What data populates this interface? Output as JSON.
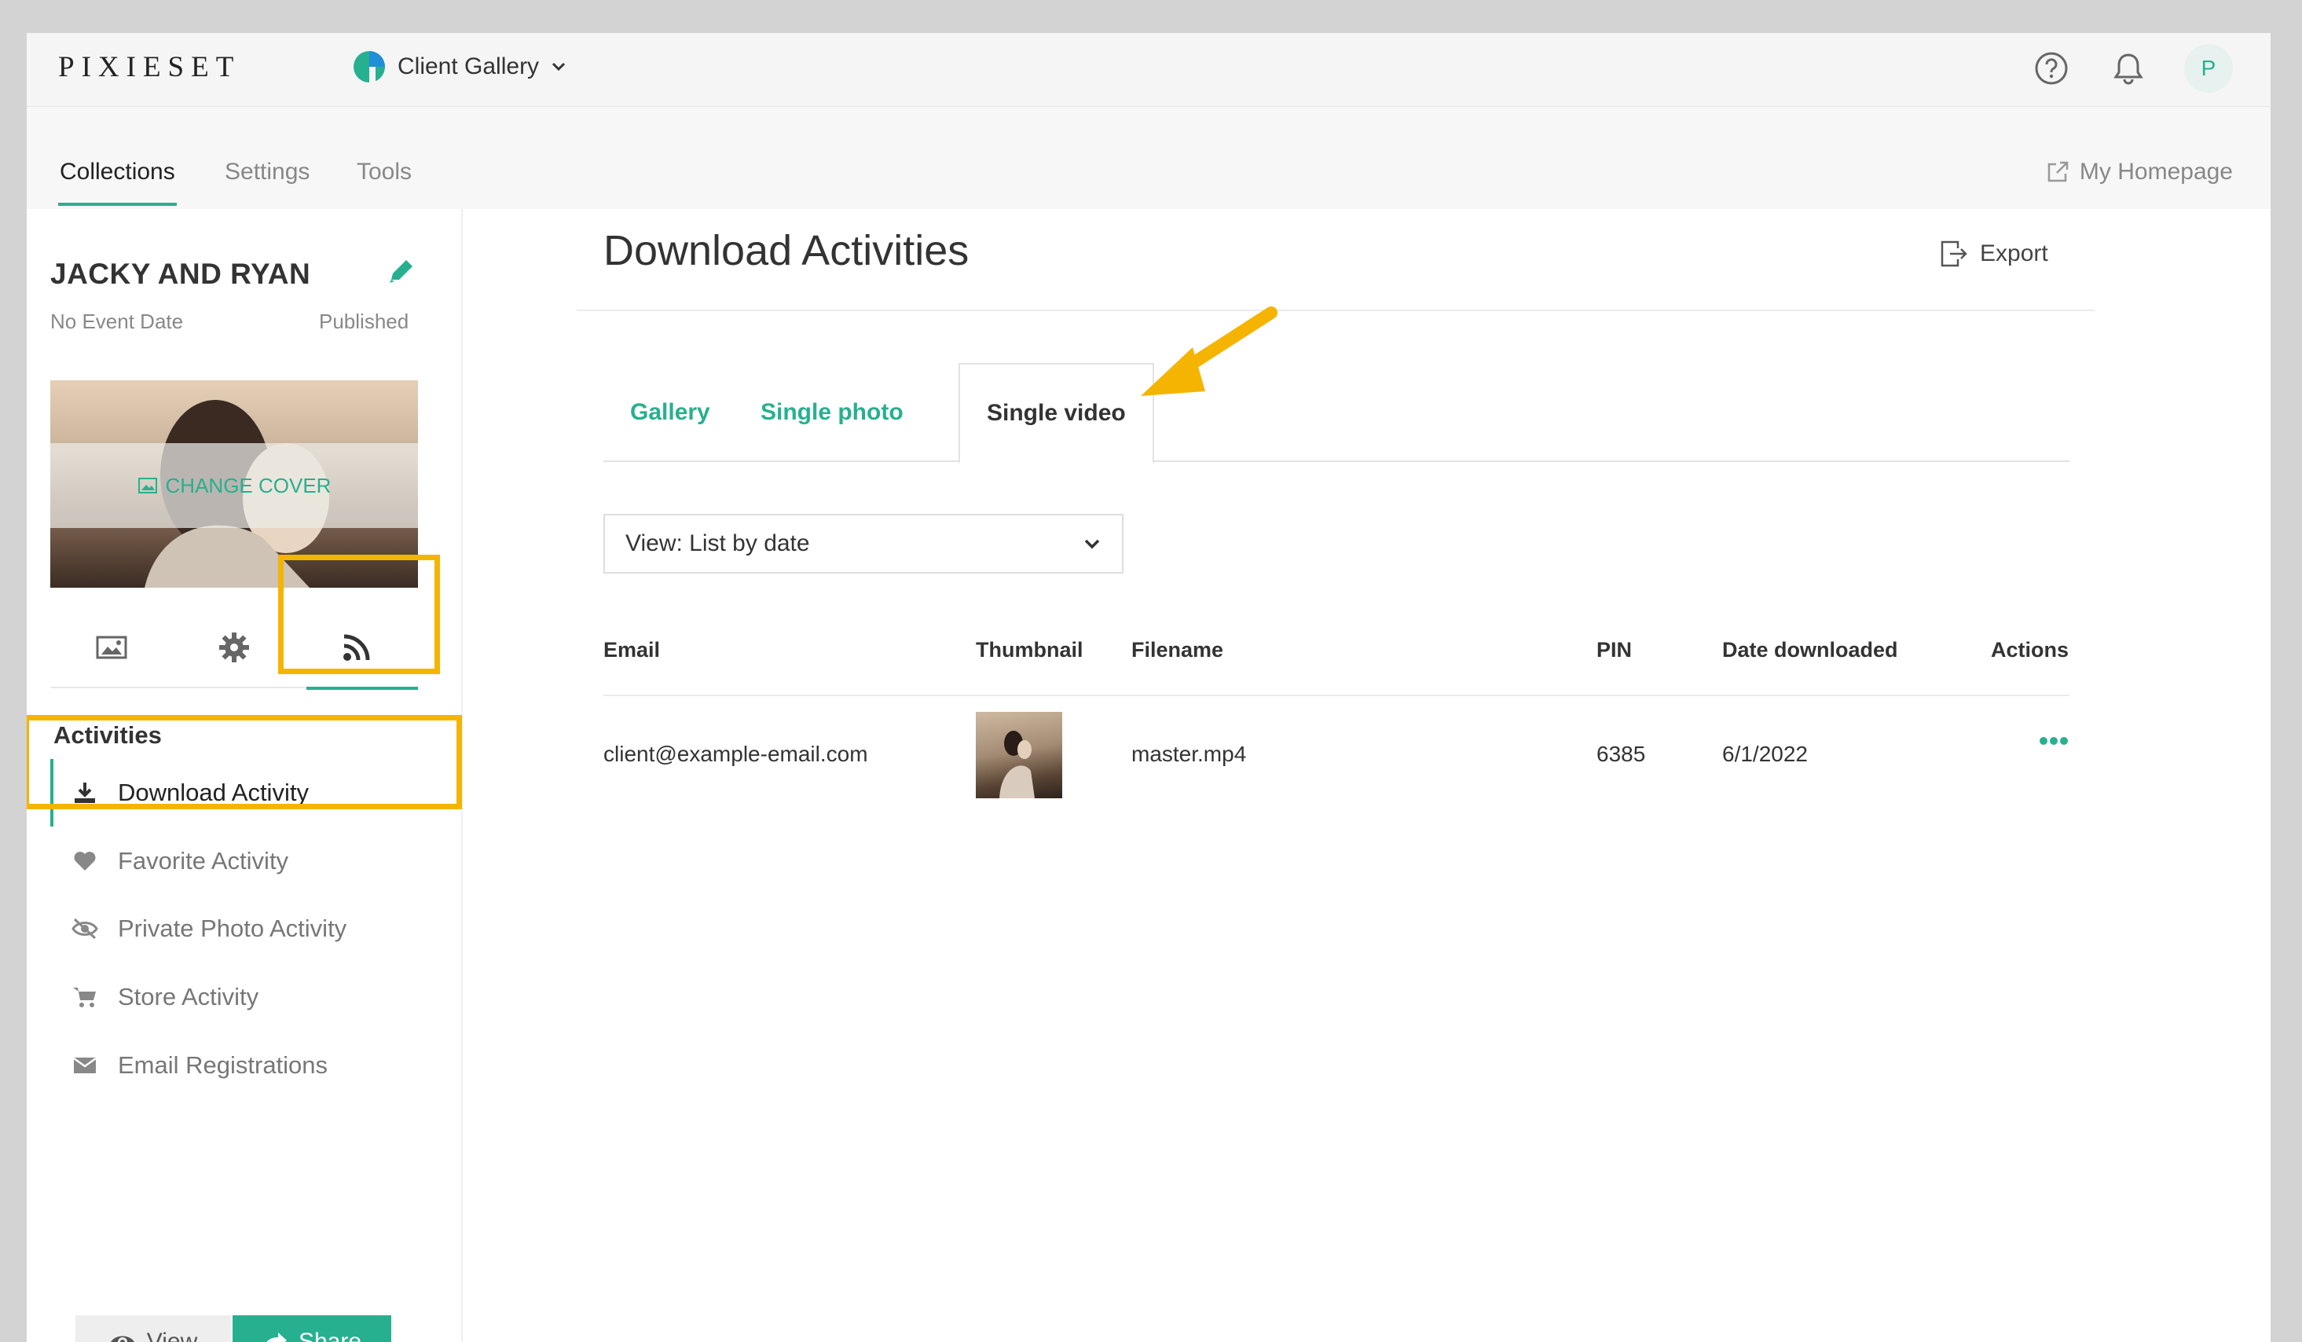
{
  "topbar": {
    "logo": "PIXIESET",
    "app_switch_label": "Client Gallery",
    "avatar_initial": "P"
  },
  "nav": {
    "tabs": [
      {
        "label": "Collections",
        "active": true
      },
      {
        "label": "Settings",
        "active": false
      },
      {
        "label": "Tools",
        "active": false
      }
    ],
    "homepage_label": "My Homepage"
  },
  "sidebar": {
    "collection_title": "JACKY AND RYAN",
    "event_date": "No Event Date",
    "status": "Published",
    "change_cover_label": "CHANGE COVER",
    "tabs": [
      {
        "icon": "image-icon",
        "active": false
      },
      {
        "icon": "gear-icon",
        "active": false
      },
      {
        "icon": "rss-icon",
        "active": true
      }
    ],
    "section_heading": "Activities",
    "items": [
      {
        "label": "Download Activity",
        "icon": "download-icon",
        "active": true
      },
      {
        "label": "Favorite Activity",
        "icon": "heart-icon",
        "active": false
      },
      {
        "label": "Private Photo Activity",
        "icon": "eye-slash-icon",
        "active": false
      },
      {
        "label": "Store Activity",
        "icon": "cart-icon",
        "active": false
      },
      {
        "label": "Email Registrations",
        "icon": "envelope-icon",
        "active": false
      }
    ],
    "view_label": "View",
    "share_label": "Share"
  },
  "main": {
    "title": "Download Activities",
    "export_label": "Export",
    "tabs": [
      {
        "label": "Gallery",
        "active": false
      },
      {
        "label": "Single photo",
        "active": false
      },
      {
        "label": "Single video",
        "active": true
      }
    ],
    "view_select": "View: List by date",
    "table": {
      "columns": [
        "Email",
        "Thumbnail",
        "Filename",
        "PIN",
        "Date downloaded",
        "Actions"
      ],
      "rows": [
        {
          "email": "client@example-email.com",
          "filename": "master.mp4",
          "pin": "6385",
          "date": "6/1/2022"
        }
      ]
    }
  },
  "colors": {
    "accent": "#27b08f",
    "highlight": "#f5b400",
    "window_bg": "#d3d3d3"
  }
}
